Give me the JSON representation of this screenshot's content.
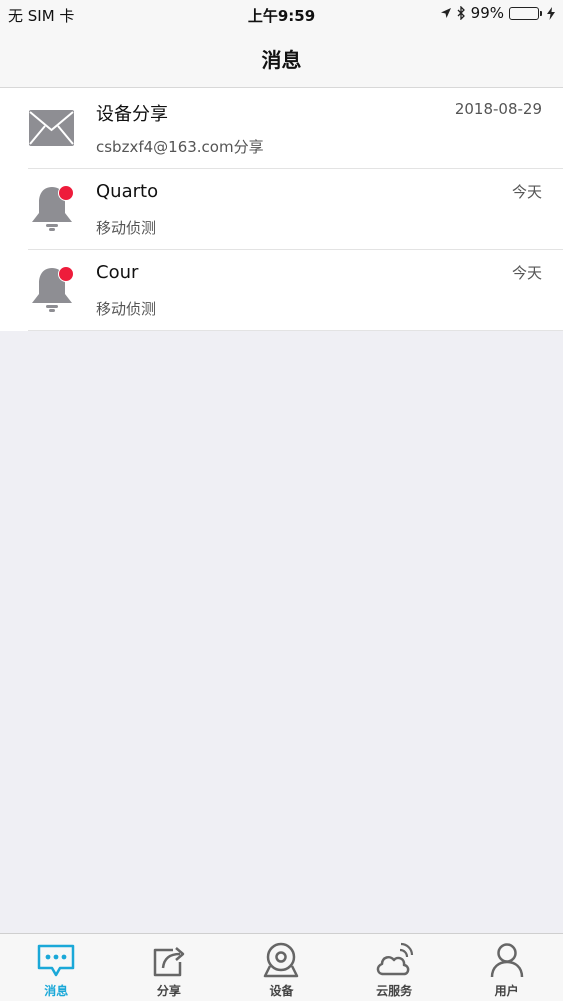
{
  "status_bar": {
    "carrier": "无 SIM 卡",
    "time": "上午9:59",
    "battery": "99%",
    "battery_level": 0.99
  },
  "nav": {
    "title": "消息"
  },
  "messages": [
    {
      "icon": "envelope-icon",
      "title": "设备分享",
      "subtitle": "csbzxf4@163.com分享",
      "time": "2018-08-29",
      "unread": false
    },
    {
      "icon": "bell-icon",
      "title": "Quarto",
      "subtitle": "移动侦测",
      "time": "今天",
      "unread": true
    },
    {
      "icon": "bell-icon",
      "title": "Cour",
      "subtitle": "移动侦测",
      "time": "今天",
      "unread": true
    }
  ],
  "tabs": [
    {
      "label": "消息",
      "icon": "message-icon",
      "active": true
    },
    {
      "label": "分享",
      "icon": "share-icon",
      "active": false
    },
    {
      "label": "设备",
      "icon": "camera-icon",
      "active": false
    },
    {
      "label": "云服务",
      "icon": "cloud-icon",
      "active": false
    },
    {
      "label": "用户",
      "icon": "user-icon",
      "active": false
    }
  ],
  "colors": {
    "accent": "#1aa8d8",
    "unread_dot": "#ee1c3b",
    "icon_gray": "#8e8e93",
    "battery": "#4cd964"
  }
}
